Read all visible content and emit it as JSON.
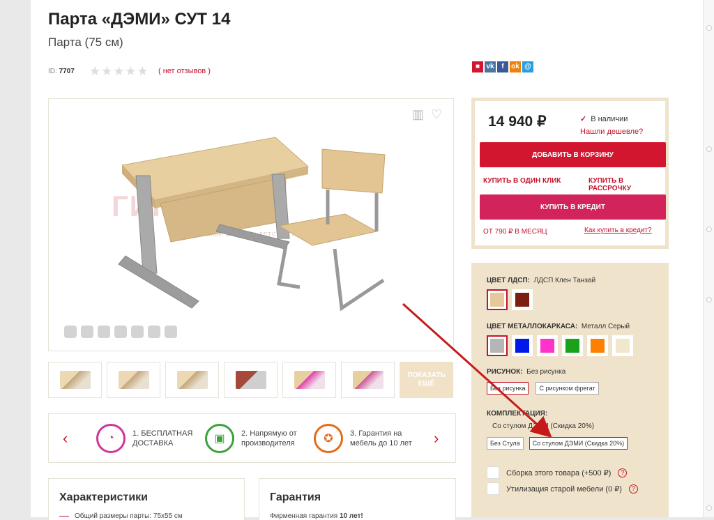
{
  "product": {
    "title": "Парта «ДЭМИ» СУТ 14",
    "subtitle": "Парта (75 см)",
    "id_label": "ID:",
    "id_value": "7707",
    "stars": "★★★★★",
    "reviews": "( нет отзывов )"
  },
  "share": [
    {
      "icon": "bookmark-icon",
      "glyph": "■",
      "color": "#d2162f"
    },
    {
      "icon": "vk-icon",
      "glyph": "vk",
      "color": "#4c75a3"
    },
    {
      "icon": "facebook-icon",
      "glyph": "f",
      "color": "#3b5998"
    },
    {
      "icon": "odnoklassniki-icon",
      "glyph": "ok",
      "color": "#ee8208"
    },
    {
      "icon": "mymail-icon",
      "glyph": "@",
      "color": "#2a9ee0"
    }
  ],
  "gallery": {
    "watermark": "ГИППАРТ",
    "watermark_sub": "ФИРМЕННЫЙ МАГАЗИН ДЕТСКИХ ПАРТ",
    "compare_icon": "bar-chart-icon",
    "favorite_icon": "heart-icon",
    "more_label": "ПОКАЗАТЬ ЕЩЁ"
  },
  "benefits": [
    {
      "text1": "1. БЕСПЛАТНАЯ",
      "text2": "ДОСТАВКА",
      "icon": "timer-icon",
      "color": "#d0359a"
    },
    {
      "text1": "2. Напрямую от",
      "text2": "производителя",
      "icon": "truck-icon",
      "color": "#3aa33a"
    },
    {
      "text1": "3. Гарантия на",
      "text2": "мебель до 10 лет",
      "icon": "medal-icon",
      "color": "#e26b1e"
    }
  ],
  "bottom": {
    "characteristics_title": "Характеристики",
    "characteristics_line": "Общий размеры парты: 75х55 см",
    "warranty_title": "Гарантия",
    "warranty_line": "Фирменная гарантия",
    "warranty_bold": "10 лет!"
  },
  "purchase": {
    "price": "14 940 ₽",
    "stock": "В наличии",
    "cheaper": "Нашли дешевле?",
    "add_to_cart": "ДОБАВИТЬ В КОРЗИНУ",
    "one_click": "КУПИТЬ В ОДИН КЛИК",
    "installment": "КУПИТЬ В РАССРОЧКУ",
    "credit": "КУПИТЬ В КРЕДИТ",
    "monthly": "ОТ 790 ₽ В МЕСЯЦ",
    "how_credit": "Как купить в кредит?"
  },
  "options": {
    "ldsp_label": "ЦВЕТ ЛДСП:",
    "ldsp_value": "ЛДСП Клен Танзай",
    "ldsp_colors": [
      "#e6c99a",
      "#7b1d12"
    ],
    "metal_label": "ЦВЕТ МЕТАЛЛОКАРКАСА:",
    "metal_value": "Металл Серый",
    "metal_colors": [
      "#b5b5b5",
      "#0019e6",
      "#ff33cc",
      "#1aa31a",
      "#ff7f00",
      "#f1e7cd"
    ],
    "pattern_label": "РИСУНОК:",
    "pattern_value": "Без рисунка",
    "pattern_chips": [
      "Без рисунка",
      "С рисунком фрегат"
    ],
    "kit_label": "КОМПЛЕКТАЦИЯ:",
    "kit_value": "Со стулом ДЭМИ (Скидка 20%)",
    "kit_chips": [
      "Без Стула",
      "Со стулом ДЭМИ (Скидка 20%)"
    ],
    "assembly": "Сборка этого товара (+500 ₽)",
    "disposal": "Утилизация старой мебели (0 ₽)"
  }
}
